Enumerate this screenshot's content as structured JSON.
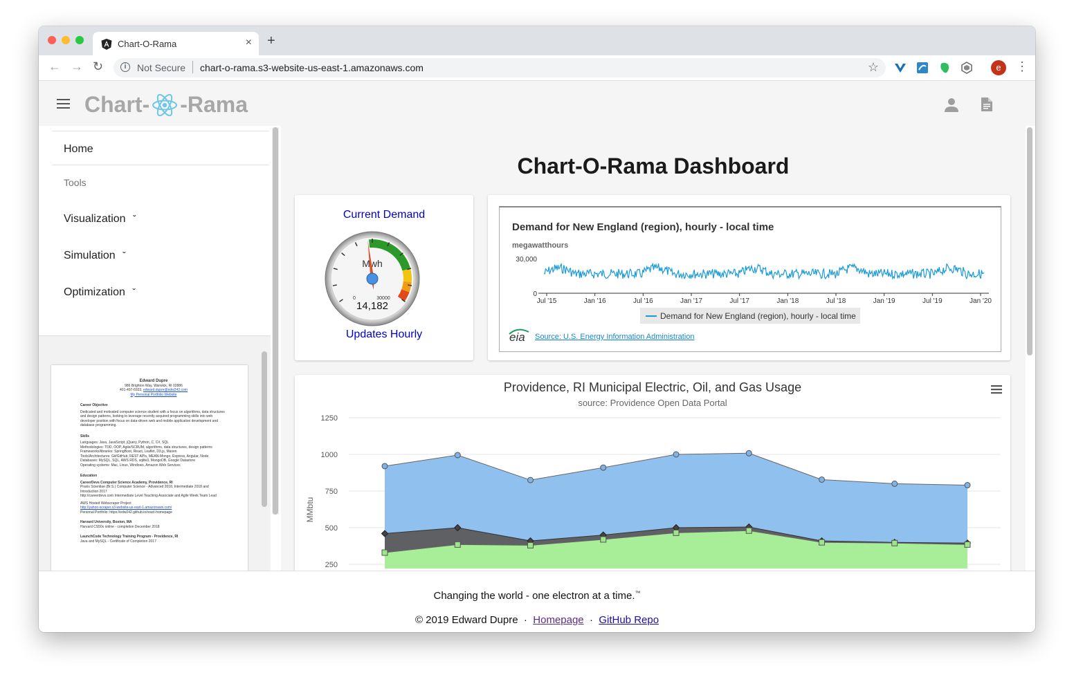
{
  "browser": {
    "tab_title": "Chart-O-Rama",
    "new_tab": "+",
    "security_label": "Not Secure",
    "url": "chart-o-rama.s3-website-us-east-1.amazonaws.com",
    "profile_initial": "e"
  },
  "app": {
    "brand_left": "Chart-",
    "brand_right": "-Rama"
  },
  "sidebar": {
    "items": [
      {
        "label": "Home"
      },
      {
        "label": "Tools"
      },
      {
        "label": "Visualization",
        "chevron": "ˇ"
      },
      {
        "label": "Simulation",
        "chevron": "ˇ"
      },
      {
        "label": "Optimization",
        "chevron": "ˇ"
      }
    ]
  },
  "resume": {
    "name": "Edward Dupre",
    "address": "986 Brighton Way, Warwick, RI 02886",
    "contact": "401-497-6933,",
    "email": "edward.dupre@edw242.com",
    "portfolio": "My Personal Portfolio Website",
    "objective_title": "Career Objective",
    "objective_text": "Dedicated and motivated computer science student with a focus on algorithms, data structures and design patterns, looking to leverage recently acquired programming skills into web developer position with focus on data-driven web and mobile application development and database programming.",
    "skills_title": "Skills",
    "skills": [
      "Languages: Java, JavaScript, jQuery, Python, C, C#, SQL",
      "Methodologies: TDD, OOP, Agile/SCRUM, algorithms, data structures, design patterns",
      "Frameworks/libraries: SpringBoot, React, Leaflet, D3.js, Maven",
      "Tools/Architectures: Git/GitHub, REST APIs, MEAN-Mongo, Express, Angular, Node",
      "Databases: MySQL, SQL, AWS RDS, sqlite3, MongoDB, Google Datastore",
      "Operating systems: Mac, Linux, Windows, Amazon Web Services"
    ],
    "education_title": "Education",
    "education": [
      "CareerDevs Computer Science Academy, Providence, RI",
      "Praxis Scientiae (Br.S.) Computer Science - Advanced 2018, Intermediate 2018 and Introduction 2017",
      "http://careerdevs.com  Intermediate Level Teaching Associate and Agile Week Team Lead",
      "AWS Hosted Webscraper Project",
      "http://yahoo-scraper.s3-website-us-east-1.amazonaws.com/",
      "Personal Portfolio:  https://edw242.github.io/react-homepage",
      "Harvard University, Boston, MA",
      "Harvard CS50x online - completion December 2018",
      "LaunchCode Technology Training Program - Providence, RI",
      "Java and MySQL - Certificate of Completion 2017"
    ]
  },
  "main": {
    "title": "Chart-O-Rama Dashboard"
  },
  "gauge": {
    "title": "Current Demand",
    "unit": "Mwh",
    "min_label": "0",
    "max_label": "30000",
    "value_label": "14,182",
    "value": 14182,
    "max": 30000,
    "footer": "Updates Hourly"
  },
  "eia_chart": {
    "title": "Demand for New England (region), hourly - local time",
    "ylabel": "megawatthours",
    "y_ticks": [
      "30,000",
      "0"
    ],
    "x_ticks": [
      "Jul '15",
      "Jan '16",
      "Jul '16",
      "Jan '17",
      "Jul '17",
      "Jan '18",
      "Jul '18",
      "Jan '19",
      "Jul '19",
      "Jan '20"
    ],
    "legend": "Demand for New England (region), hourly - local time",
    "source_logo": "eia",
    "source": "Source: U.S. Energy Information Administration",
    "colors": {
      "line": "#1a9ad6"
    }
  },
  "area_chart": {
    "title": "Providence, RI Municipal Electric, Oil, and Gas Usage",
    "subtitle": "source: Providence Open Data Portal",
    "menu_icon": "hamburger-icon"
  },
  "chart_data": {
    "type": "area",
    "ylabel": "MMbtu",
    "y_ticks": [
      250,
      500,
      750,
      1000,
      1250
    ],
    "ylim": [
      250,
      1250
    ],
    "grid": true,
    "series": [
      {
        "values": [
          920,
          995,
          825,
          910,
          1000,
          1008,
          828,
          800,
          790
        ],
        "color": "#90c0ee"
      },
      {
        "values": [
          460,
          500,
          410,
          450,
          500,
          505,
          410,
          400,
          395
        ],
        "color": "#5f6063"
      },
      {
        "values": [
          330,
          385,
          380,
          420,
          465,
          480,
          400,
          395,
          385
        ],
        "color": "#a8ee98"
      }
    ]
  },
  "footer": {
    "tagline": "Changing the world - one electron at a time.",
    "tm": "™",
    "copyright": "© 2019 Edward Dupre",
    "sep": "·",
    "homepage": "Homepage",
    "github": "GitHub Repo"
  }
}
